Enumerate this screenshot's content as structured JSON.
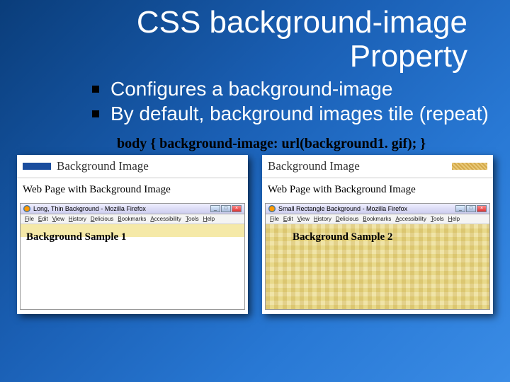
{
  "title_line1": "CSS background-image",
  "title_line2": "Property",
  "bullets": [
    "Configures a background-image",
    "By default, background images tile (repeat)"
  ],
  "code": "body { background-image: url(background1. gif); }",
  "examples": {
    "left": {
      "panel_title": "Background Image",
      "subtitle": "Web Page with Background Image",
      "browser_title": "Long, Thin Background - Mozilla Firefox",
      "menu": [
        "File",
        "Edit",
        "View",
        "History",
        "Delicious",
        "Bookmarks",
        "Accessibility",
        "Tools",
        "Help"
      ],
      "sample_heading": "Background Sample 1"
    },
    "right": {
      "panel_title": "Background Image",
      "subtitle": "Web Page with Background Image",
      "browser_title": "Small Rectangle Background - Mozilla Firefox",
      "menu": [
        "File",
        "Edit",
        "View",
        "History",
        "Delicious",
        "Bookmarks",
        "Accessibility",
        "Tools",
        "Help"
      ],
      "sample_heading": "Background Sample 2"
    }
  },
  "window_buttons": {
    "min": "_",
    "max": "□",
    "close": "×"
  }
}
